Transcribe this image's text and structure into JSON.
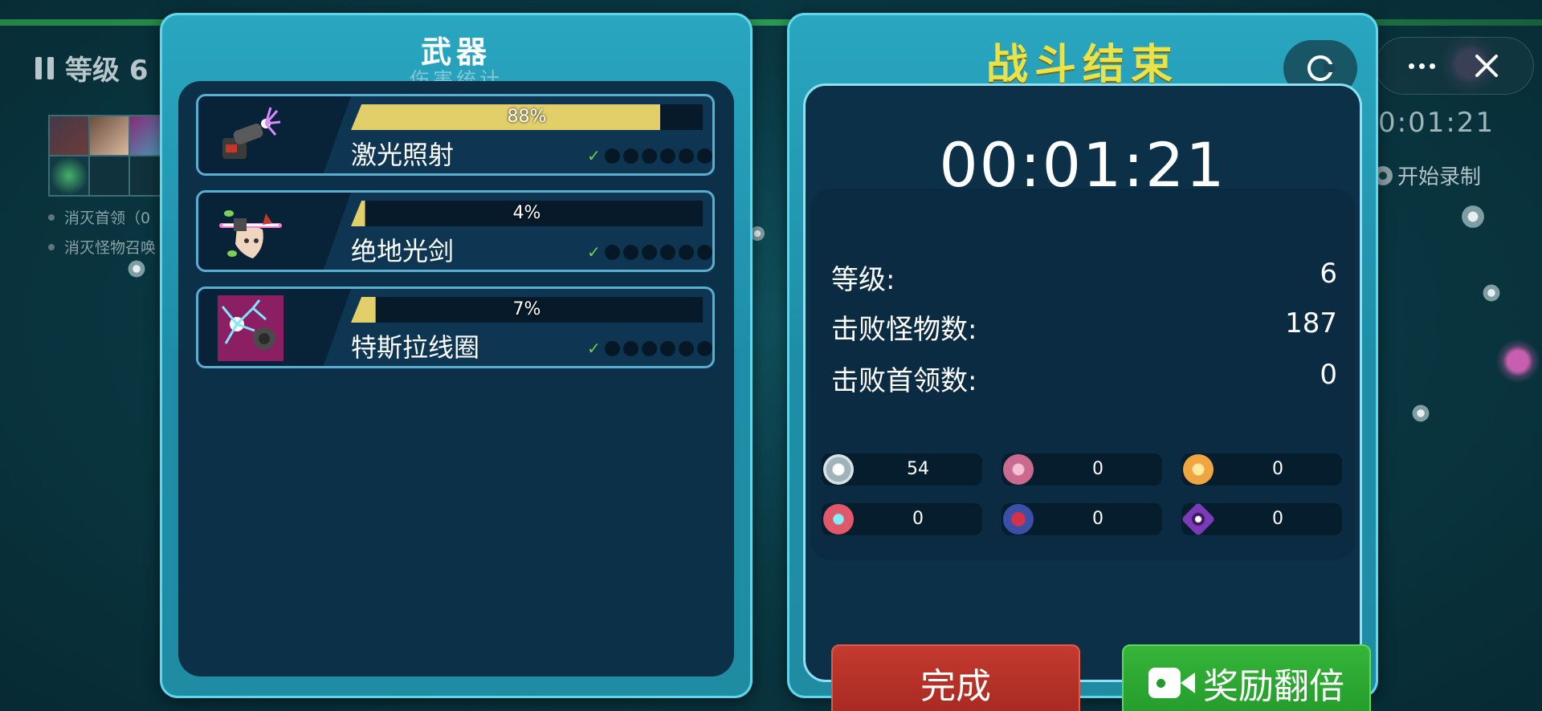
{
  "hud": {
    "level_label": "等级 6",
    "timer": "0:01:21",
    "record_label": "开始录制",
    "tasks": [
      "消灭首领（0",
      "消灭怪物召唤"
    ]
  },
  "weapons_panel": {
    "title": "武器",
    "subtitle": "伤害统计",
    "weapons": [
      {
        "name": "激光照射",
        "damage_pct": "88%",
        "fill": 0.88,
        "level": 1,
        "max_level": 8,
        "icon": "laser-turret-icon"
      },
      {
        "name": "绝地光剑",
        "damage_pct": "4%",
        "fill": 0.04,
        "level": 1,
        "max_level": 8,
        "icon": "lightsaber-creature-icon"
      },
      {
        "name": "特斯拉线圈",
        "damage_pct": "7%",
        "fill": 0.07,
        "level": 1,
        "max_level": 8,
        "icon": "tesla-coil-icon"
      }
    ]
  },
  "result_panel": {
    "title": "战斗结束",
    "timer": "00:01:21",
    "stats": [
      {
        "label": "等级:",
        "value": "6"
      },
      {
        "label": "击败怪物数:",
        "value": "187"
      },
      {
        "label": "击败首领数:",
        "value": "0"
      }
    ],
    "loot": [
      {
        "icon": "white-cell-icon",
        "color": "#d8e4e6",
        "value": "54"
      },
      {
        "icon": "pink-virus-icon",
        "color": "#c96a8e",
        "value": "0"
      },
      {
        "icon": "orange-spore-icon",
        "color": "#f0a640",
        "value": "0"
      },
      {
        "icon": "red-cell-icon",
        "color": "#e0586a",
        "value": "0"
      },
      {
        "icon": "blue-red-orb-icon",
        "color": "#3b4fa8",
        "value": "0"
      },
      {
        "icon": "purple-diamond-icon",
        "color": "#7b3bb8",
        "value": "0"
      }
    ],
    "done_label": "完成",
    "double_label": "奖励翻倍"
  },
  "colors": {
    "panel": "#1f8ca4",
    "inner": "#0d3049",
    "title_yellow": "#e8e34b",
    "bar_yellow": "#e3cf6a",
    "done_red": "#b0302a",
    "double_green": "#2ea833"
  }
}
